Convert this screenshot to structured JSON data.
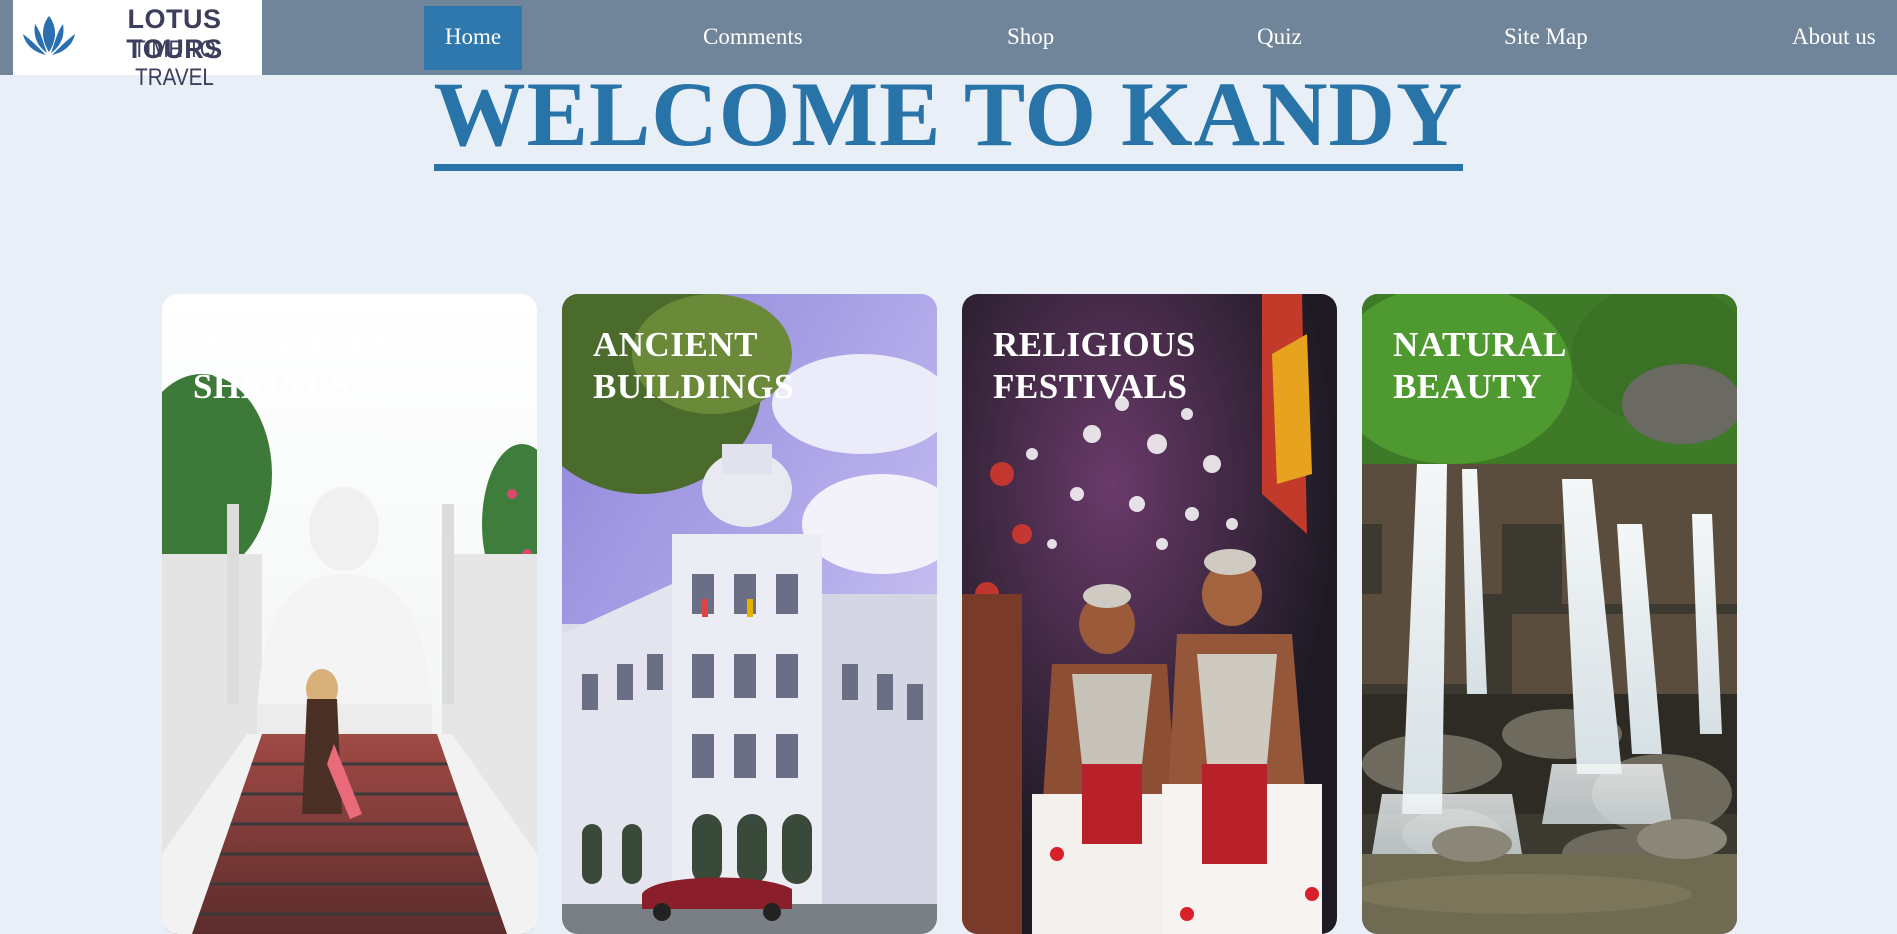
{
  "logo": {
    "brand": "LOTUS TOURS",
    "tagline": "TIME TO TRAVEL",
    "icon": "lotus-icon"
  },
  "nav": {
    "items": [
      {
        "label": "Home",
        "active": true
      },
      {
        "label": "Comments",
        "active": false
      },
      {
        "label": "Shop",
        "active": false
      },
      {
        "label": "Quiz",
        "active": false
      },
      {
        "label": "Site Map",
        "active": false
      },
      {
        "label": "About us",
        "active": false
      }
    ]
  },
  "page": {
    "title": "WELCOME TO KANDY"
  },
  "cards": [
    {
      "line1": "RELIGIOUS",
      "line2": "SHRINES"
    },
    {
      "line1": "ANCIENT",
      "line2": "BUILDINGS"
    },
    {
      "line1": "RELIGIOUS",
      "line2": "FESTIVALS"
    },
    {
      "line1": "NATURAL",
      "line2": "BEAUTY"
    }
  ],
  "colors": {
    "navbar": "#71859a",
    "active_nav": "#2e78ad",
    "title": "#2874a8",
    "background": "#e9eff6"
  }
}
